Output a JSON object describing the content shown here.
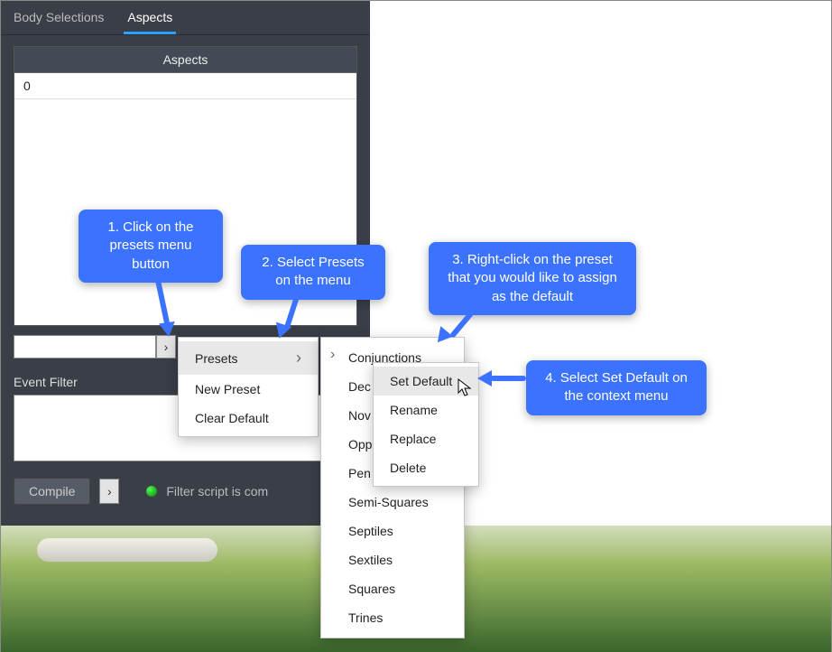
{
  "tabs": {
    "body_selections": "Body Selections",
    "aspects": "Aspects"
  },
  "aspects": {
    "header": "Aspects",
    "row0": "0"
  },
  "event_filter_label": "Event Filter",
  "compile": {
    "label": "Compile",
    "status": "Filter script is com"
  },
  "menu_presets": {
    "presets": "Presets",
    "new_preset": "New Preset",
    "clear_default": "Clear Default"
  },
  "menu_preset_list": {
    "items": [
      "Conjunctions",
      "Dec",
      "Nov",
      "Opp",
      "Pen",
      "Semi-Squares",
      "Septiles",
      "Sextiles",
      "Squares",
      "Trines"
    ]
  },
  "context_menu": {
    "set_default": "Set Default",
    "rename": "Rename",
    "replace": "Replace",
    "delete": "Delete"
  },
  "callouts": {
    "c1": "1. Click on the presets menu button",
    "c2": "2. Select Presets on the menu",
    "c3": "3. Right-click on the preset that you would like to assign as the default",
    "c4": "4. Select Set Default on the context menu"
  }
}
